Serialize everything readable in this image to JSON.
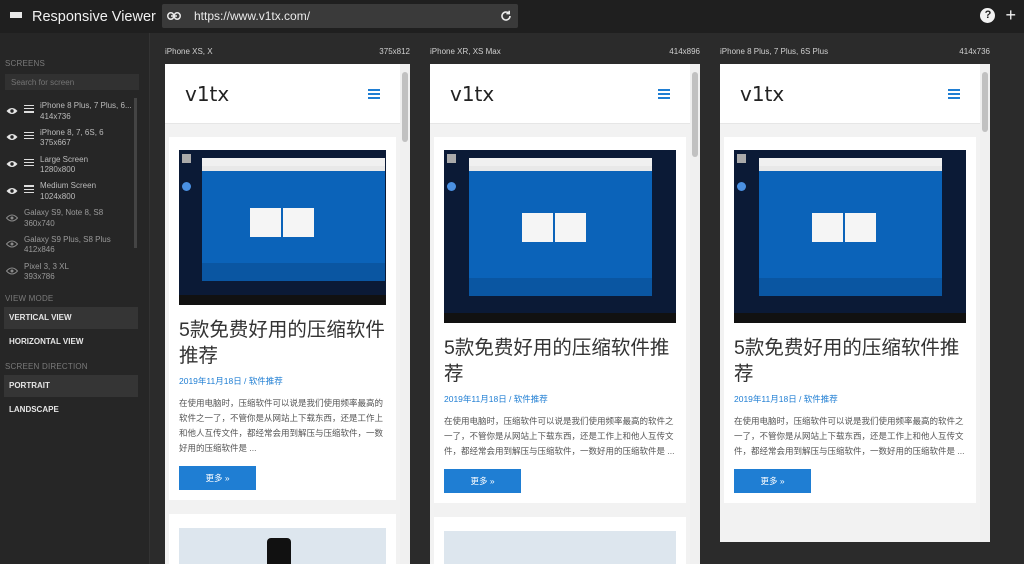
{
  "app": {
    "title": "Responsive Viewer"
  },
  "address": {
    "url": "https://www.v1tx.com/"
  },
  "sidebar": {
    "screens_label": "SCREENS",
    "search_placeholder": "Search for screen",
    "screens": [
      {
        "name": "iPhone 8 Plus, 7 Plus, 6...",
        "size": "414x736",
        "visible": true
      },
      {
        "name": "iPhone 8, 7, 6S, 6",
        "size": "375x667",
        "visible": true
      },
      {
        "name": "Large Screen",
        "size": "1280x800",
        "visible": true
      },
      {
        "name": "Medium Screen",
        "size": "1024x800",
        "visible": true
      },
      {
        "name": "Galaxy S9, Note 8, S8",
        "size": "360x740",
        "visible": false
      },
      {
        "name": "Galaxy S9 Plus, S8 Plus",
        "size": "412x846",
        "visible": false
      },
      {
        "name": "Pixel 3, 3 XL",
        "size": "393x786",
        "visible": false
      }
    ],
    "view_mode_label": "VIEW MODE",
    "view_modes": [
      "VERTICAL VIEW",
      "HORIZONTAL VIEW"
    ],
    "screen_direction_label": "SCREEN DIRECTION",
    "directions": [
      "PORTRAIT",
      "LANDSCAPE"
    ]
  },
  "viewers": [
    {
      "device": "iPhone XS, X",
      "size": "375x812"
    },
    {
      "device": "iPhone XR, XS Max",
      "size": "414x896"
    },
    {
      "device": "iPhone 8 Plus, 7 Plus, 6S Plus",
      "size": "414x736"
    }
  ],
  "site": {
    "logo": "v1tx",
    "post": {
      "title": "5款免费好用的压缩软件推荐",
      "meta": "2019年11月18日 / 软件推荐",
      "excerpt": "在使用电脑时，压缩软件可以说是我们使用频率最高的软件之一了，不管你是从网站上下载东西，还是工作上和他人互传文件，都经常会用到解压与压缩软件，一数好用的压缩软件是 ...",
      "more": "更多 »"
    }
  },
  "colors": {
    "accent": "#1f7ed3",
    "topbar": "#1f1f1f",
    "sidebar": "#262626"
  }
}
